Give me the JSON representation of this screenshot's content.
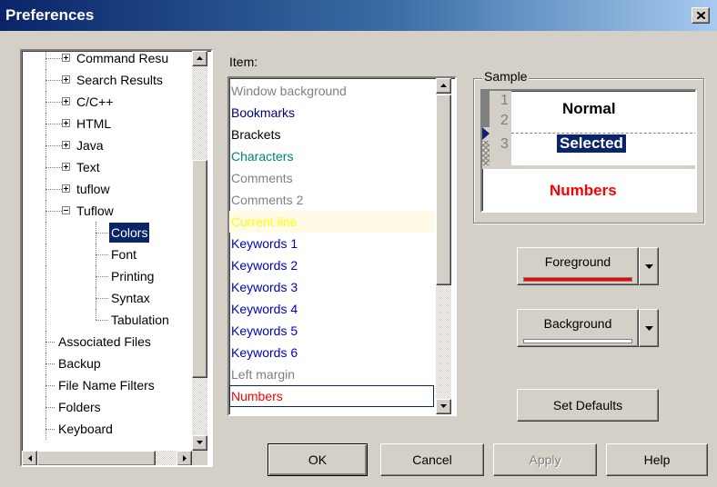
{
  "window": {
    "title": "Preferences"
  },
  "tree": {
    "items": [
      {
        "label": "Command Resu",
        "expander": "plus"
      },
      {
        "label": "Search Results",
        "expander": "plus"
      },
      {
        "label": "C/C++",
        "expander": "plus"
      },
      {
        "label": "HTML",
        "expander": "plus"
      },
      {
        "label": "Java",
        "expander": "plus"
      },
      {
        "label": "Text",
        "expander": "plus"
      },
      {
        "label": "tuflow",
        "expander": "plus"
      },
      {
        "label": "Tuflow",
        "expander": "minus"
      },
      {
        "label": "Colors",
        "selected": true
      },
      {
        "label": "Font"
      },
      {
        "label": "Printing"
      },
      {
        "label": "Syntax"
      },
      {
        "label": "Tabulation"
      },
      {
        "label": "Associated Files"
      },
      {
        "label": "Backup"
      },
      {
        "label": "File Name Filters"
      },
      {
        "label": "Folders"
      },
      {
        "label": "Keyboard"
      }
    ]
  },
  "items_panel": {
    "label": "Item:",
    "items": [
      {
        "label": "Window background",
        "color": "#808080"
      },
      {
        "label": "Bookmarks",
        "color": "#000080"
      },
      {
        "label": "Brackets",
        "color": "#000000"
      },
      {
        "label": "Characters",
        "color": "#008080"
      },
      {
        "label": "Comments",
        "color": "#808080"
      },
      {
        "label": "Comments 2",
        "color": "#808080"
      },
      {
        "label": "Current line",
        "color": "#ffff00"
      },
      {
        "label": "Keywords 1",
        "color": "#0000c0"
      },
      {
        "label": "Keywords 2",
        "color": "#0000c0"
      },
      {
        "label": "Keywords 3",
        "color": "#0000c0"
      },
      {
        "label": "Keywords 4",
        "color": "#0000c0"
      },
      {
        "label": "Keywords 5",
        "color": "#0000c0"
      },
      {
        "label": "Keywords 6",
        "color": "#0000c0"
      },
      {
        "label": "Left margin",
        "color": "#808080"
      },
      {
        "label": "Numbers",
        "color": "#ff0000",
        "selected": true
      }
    ]
  },
  "sample": {
    "label": "Sample",
    "line_numbers": [
      "1",
      "2",
      "3"
    ],
    "normal_text": "Normal",
    "selected_text": "Selected",
    "numbers_text": "Numbers",
    "numbers_color": "#ff0000"
  },
  "buttons": {
    "foreground": "Foreground",
    "foreground_color": "#ff0000",
    "background": "Background",
    "background_color": "#ffffff",
    "set_defaults": "Set Defaults",
    "ok": "OK",
    "cancel": "Cancel",
    "apply": "Apply",
    "help": "Help"
  }
}
